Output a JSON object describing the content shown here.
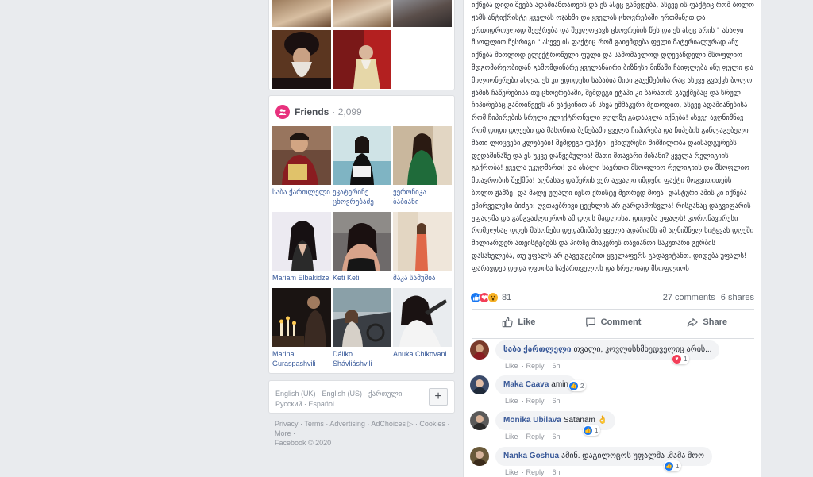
{
  "friends": {
    "title": "Friends",
    "count": "2,099",
    "list": [
      {
        "name": "საბა ქართლელი"
      },
      {
        "name": "ეკატერინე ცხოვრებაძე"
      },
      {
        "name": "ვერონიკა ბაბიანი"
      },
      {
        "name": "Mariam Elbakidze"
      },
      {
        "name": "Keti Keti"
      },
      {
        "name": "მაკა სამუშია"
      },
      {
        "name": "Marina Guraspashvili"
      },
      {
        "name": "Dáliko Shávliáshvili"
      },
      {
        "name": "Anuka Chikovani"
      }
    ]
  },
  "languages": {
    "items": [
      "English (UK)",
      "English (US)",
      "ქართული",
      "Русский",
      "Español"
    ],
    "plus": "+"
  },
  "footer": {
    "links": [
      "Privacy",
      "Terms",
      "Advertising",
      "AdChoices",
      "Cookies",
      "More"
    ],
    "copyright": "Facebook © 2020"
  },
  "post": {
    "text": "იქნება დიდი შვება ადამიანთათვის და ეს ასეც განვდება, ასევე ის ფაქტიც რომ ბოლო ჟამს ანტიქრისტე ყველას ოჯახში და ყველას ცხოვრებაში ერთმანეთ და ერთიდროულად შეეჭრება და შეულოცავს ცხოვრების წეს და ეს ასეც არის \" ახალი მსოფლიო წესრიგი \" ასევე ის ფაქტიც რომ გაიუმდება ფული მატერიალურად ანუ იქნება მხოლოდ ელექტრონული ფული და სამომავლოდ დღევანდელი მსოფლიო მდგომარეობიდან გამომდინარე ყველანაირი ბიზნესი მიწაში ჩაიფლება ანუ ფული და მილიონერები ახლა, ეს კი უდიდესი საბაბია მისი გაუქმებისა რაც ასევე გვაქვს ბოლო ჟამის ჩაწერებისა თუ ცხოვრებაში, შემდეგი ეტაპი კი ბარათის გაუქმებაც და სრულ ჩიპირებაც გამოიწვევს ან ვაქცინით ან სხვა ეშმაკური მეთოდით, ასევე ადამიანებისა რომ ჩიპირების სრული ელექტრონული ფულზე გადასვლა იქნება! ასევე ავღნიშნავ რომ დიდი დღეები და მასონთა ბუნებაში ყველა ჩიპირება და ჩიპების განლაგებელი მათი ლოცვები კლუბები! შემდეგი ფაქტი! უპიდურესი შიმშილობა დაისადგურებს დედამიწაზე და ეს უკვე დაწყებულია! მათი მთავარი მიზანი? ყველა რელიგიის გაქრობა! ყველა უკუღმართ! და ახალი საერთო მსოფლიო რელიგიის და მსოფლიო მთავრობის შექმნა! აღმასაც დაწერის ვერ აუვალი იმდენი ფაქტი მოგვითითებს ბოლო ჟამზე! და მალე უფალი იესო ქრისტე მეორედ მოვა! დასტური ამის კი იქნება უპირველესი ბიძგი: ღვთაებრივი ცეცხლის არ გარდამოსვლა! რისგანაც დაგვიფარის უფალმა და განგვაძლიეროს ამ დღის მადლისა, დიდება უფალს! კორონავირუსი რომელსაც დღეს მასონები დედამიწაზე ყველა ადამიანს ამ აღნიშნულ სიტყვას დღეში მილიარდერ ათეისტებებს და პირზე მიაკერეს თავიანთი საკუთარი გერბის დასახელება, თუ უფალს არ გავუდგებით ყველაფერს გადავიტანთ. დიდება უფალს! ფარავდეს დედა ღვთისა საქართველოს და სრულიად მსოფლიოს",
    "reaction_count": "81",
    "comments_count": "27 comments",
    "shares_count": "6 shares",
    "actions": {
      "like": "Like",
      "comment": "Comment",
      "share": "Share"
    }
  },
  "comments": [
    {
      "author": "საბა ქართლელი",
      "text": "თვალი, კოვლისხმხედველიც არის...",
      "like": "Like",
      "reply": "Reply",
      "time": "6h",
      "react_count": "1",
      "react_type": "love"
    },
    {
      "author": "Maka Caava",
      "text": "amin",
      "like": "Like",
      "reply": "Reply",
      "time": "6h",
      "react_count": "2",
      "react_type": "like"
    },
    {
      "author": "Monika Ubilava",
      "text": "Satanam 👌",
      "like": "Like",
      "reply": "Reply",
      "time": "6h",
      "react_count": "1",
      "react_type": "like"
    },
    {
      "author": "Nanka Goshua",
      "text": "ამინ. დაგილოცოს უფალმა .მამა მოო",
      "like": "Like",
      "reply": "Reply",
      "time": "6h",
      "react_count": "1",
      "react_type": "like"
    }
  ],
  "colors": {
    "accent": "#385898",
    "friends_badge": "#e8317d",
    "love": "#f33e58",
    "like": "#1877f2",
    "haha": "#f7b125"
  }
}
